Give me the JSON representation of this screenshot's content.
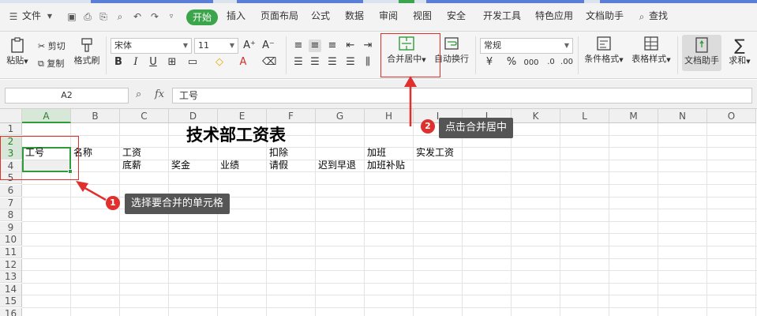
{
  "menubar": {
    "file": "文件",
    "start": "开始",
    "tabs": [
      "插入",
      "页面布局",
      "公式",
      "数据",
      "审阅",
      "视图",
      "安全",
      "开发工具",
      "特色应用",
      "文档助手"
    ],
    "search": "查找"
  },
  "toolbar": {
    "paste": "粘贴",
    "cut": "剪切",
    "copy": "复制",
    "format_painter": "格式刷",
    "font_name": "宋体",
    "font_size": "11",
    "grow_font": "A⁺",
    "shrink_font": "A⁻",
    "bold": "B",
    "italic": "I",
    "underline": "U",
    "merge_center": "合并居中",
    "wrap_text": "自动换行",
    "number_format": "常规",
    "percent": "%",
    "comma": "000",
    "conditional_format": "条件格式",
    "table_style": "表格样式",
    "doc_assistant": "文档助手",
    "sum": "求和"
  },
  "formula_bar": {
    "cell_ref": "A2",
    "fx": "fx",
    "content": "工号"
  },
  "grid": {
    "columns": [
      "A",
      "B",
      "C",
      "D",
      "E",
      "F",
      "G",
      "H",
      "I",
      "J",
      "K",
      "L",
      "M",
      "N",
      "O"
    ],
    "rows": [
      "1",
      "2",
      "3",
      "4",
      "5",
      "6",
      "7",
      "8",
      "9",
      "10",
      "11",
      "12",
      "13",
      "14",
      "15",
      "16"
    ],
    "title": "技术部工资表",
    "row2": {
      "A": "工号",
      "B": "名称",
      "C": "工资",
      "F": "扣除",
      "H": "加班",
      "I": "实发工资"
    },
    "row3": {
      "C": "底薪",
      "D": "奖金",
      "E": "业绩",
      "F": "请假",
      "G": "迟到早退",
      "H": "加班补贴"
    }
  },
  "annotations": {
    "step1_num": "1",
    "step1_text": "选择要合并的单元格",
    "step2_num": "2",
    "step2_text": "点击合并居中"
  },
  "colors": {
    "accent_green": "#3aa54a",
    "annotation_red": "#e0302e",
    "callout_bg": "#555555"
  }
}
